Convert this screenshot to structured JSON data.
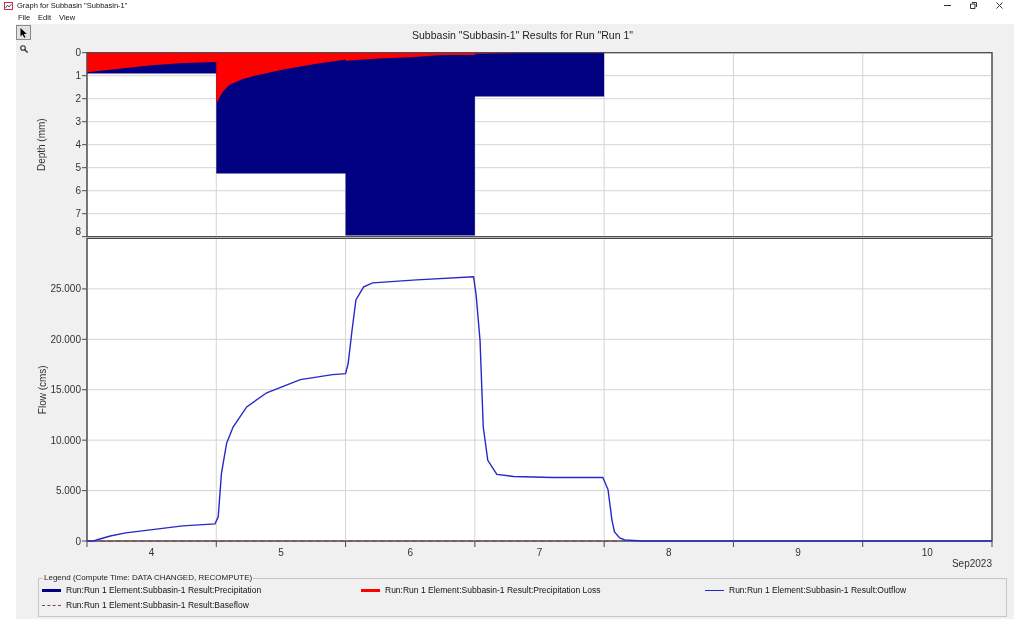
{
  "window": {
    "title": "Graph for Subbasin \"Subbasin-1\""
  },
  "menu": [
    "File",
    "Edit",
    "View"
  ],
  "toolbar": [
    {
      "kind": "pointer",
      "selected": true
    },
    {
      "kind": "zoom",
      "selected": false
    }
  ],
  "graph": {
    "title": "Subbasin \"Subbasin-1\" Results for Run \"Run 1\"",
    "depth_chart": {
      "chart_data": {
        "type": "area",
        "ylabel": "Depth (mm)",
        "x": [
          4,
          4.25,
          4.5,
          4.75,
          5,
          5,
          5.05,
          5.1,
          5.2,
          5.3,
          5.5,
          5.75,
          6,
          6,
          6.25,
          6.5,
          6.75,
          7,
          7,
          7.5,
          8,
          8,
          11
        ],
        "series": [
          {
            "name": "Run:Run 1 Element:Subbasin-1 Result:Precipitation",
            "color": "#000080",
            "values": [
              0.9,
              0.9,
              0.9,
              0.9,
              0.9,
              5.25,
              5.25,
              5.25,
              5.25,
              5.25,
              5.25,
              5.25,
              5.25,
              7.95,
              7.95,
              7.95,
              7.95,
              7.95,
              1.9,
              1.9,
              1.9,
              0,
              0
            ]
          },
          {
            "name": "Run:Run 1 Element:Subbasin-1 Result:Precipitation Loss",
            "color": "#ff0000",
            "values": [
              0.85,
              0.7,
              0.55,
              0.45,
              0.4,
              2.2,
              1.7,
              1.4,
              1.15,
              1,
              0.75,
              0.5,
              0.3,
              0.35,
              0.25,
              0.2,
              0.1,
              0.1,
              0.05,
              0,
              0,
              0,
              0
            ]
          }
        ],
        "xlim": [
          4,
          11
        ],
        "ylim": [
          8,
          0
        ],
        "yticks": [
          0,
          1,
          2,
          3,
          4,
          5,
          6,
          7,
          8
        ],
        "stacked": false,
        "grid": true
      }
    },
    "flow_chart": {
      "chart_data": {
        "type": "line",
        "xlabel": "Sep2023",
        "ylabel": "Flow (cms)",
        "x": [
          4,
          4.05,
          4.1,
          4.18,
          4.3,
          4.49,
          4.74,
          4.99,
          5.015,
          5.04,
          5.08,
          5.13,
          5.235,
          5.39,
          5.65,
          5.9,
          6,
          6.02,
          6.05,
          6.08,
          6.14,
          6.21,
          6.55,
          6.99,
          7.01,
          7.04,
          7.065,
          7.1,
          7.17,
          7.3,
          7.6,
          7.99,
          8.03,
          8.06,
          8.08,
          8.12,
          8.16,
          8.3,
          11
        ],
        "series": [
          {
            "name": "Run:Run 1 Element:Subbasin-1 Result:Outflow",
            "color": "#2828c8",
            "values": [
              0,
              0,
              200,
              500,
              800,
              1100,
              1500,
              1700,
              2400,
              6700,
              9700,
              11300,
              13300,
              14700,
              16000,
              16500,
              16600,
              17600,
              20900,
              23900,
              25200,
              25600,
              25900,
              26200,
              24400,
              19900,
              11300,
              8000,
              6600,
              6400,
              6300,
              6300,
              5100,
              2100,
              900,
              300,
              100,
              0,
              0
            ]
          },
          {
            "name": "Run:Run 1 Element:Subbasin-1 Result:Baseflow",
            "color": "#8b4040",
            "line_style": "dashed",
            "values": [
              null,
              null,
              0,
              0,
              0,
              0,
              0,
              0,
              0,
              0,
              0,
              0,
              0,
              0,
              0,
              0,
              0,
              0,
              0,
              0,
              0,
              0,
              0,
              0,
              0,
              0,
              0,
              0,
              0,
              0,
              0,
              0,
              0,
              0,
              0,
              0,
              null,
              null,
              null
            ]
          }
        ],
        "xlim": [
          4,
          11
        ],
        "ylim": [
          0,
          30000
        ],
        "xticks": [
          {
            "value": 4.5,
            "label": "4"
          },
          {
            "value": 5.5,
            "label": "5"
          },
          {
            "value": 6.5,
            "label": "6"
          },
          {
            "value": 7.5,
            "label": "7"
          },
          {
            "value": 8.5,
            "label": "8"
          },
          {
            "value": 9.5,
            "label": "9"
          },
          {
            "value": 10.5,
            "label": "10"
          }
        ],
        "yticks": [
          {
            "value": 0,
            "label": "0"
          },
          {
            "value": 5000,
            "label": "5.000"
          },
          {
            "value": 10000,
            "label": "10.000"
          },
          {
            "value": 15000,
            "label": "15.000"
          },
          {
            "value": 20000,
            "label": "20.000"
          },
          {
            "value": 25000,
            "label": "25.000"
          }
        ],
        "grid": true
      }
    },
    "legend": {
      "title": "Legend (Compute Time: DATA CHANGED, RECOMPUTE)"
    }
  }
}
